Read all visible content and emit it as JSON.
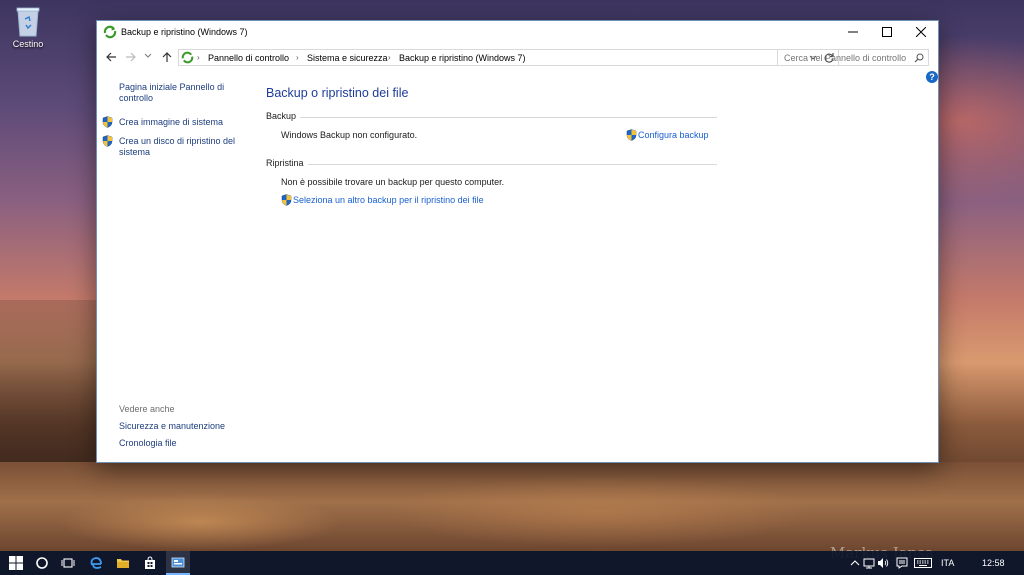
{
  "desktop": {
    "recycle_bin_label": "Cestino",
    "watermark": "Markus Jansa"
  },
  "window": {
    "title": "Backup e ripristino (Windows 7)",
    "controls": [
      "minimize-icon",
      "maximize-icon",
      "close-icon"
    ]
  },
  "address_bar": {
    "breadcrumbs": [
      "Pannello di controllo",
      "Sistema e sicurezza",
      "Backup e ripristino (Windows 7)"
    ],
    "search_placeholder": "Cerca nel Pannello di controllo"
  },
  "left_pane": {
    "home_link": "Pagina iniziale Pannello di controllo",
    "tasks": [
      {
        "label": "Crea immagine di sistema",
        "icon": "uac-shield-icon"
      },
      {
        "label": "Crea un disco di ripristino del sistema",
        "icon": "uac-shield-icon"
      }
    ],
    "see_also_heading": "Vedere anche",
    "see_also": [
      "Sicurezza e manutenzione",
      "Cronologia file"
    ]
  },
  "main": {
    "title": "Backup o ripristino dei file",
    "backup_section": {
      "heading": "Backup",
      "status": "Windows Backup non configurato.",
      "action": "Configura backup"
    },
    "restore_section": {
      "heading": "Ripristina",
      "status": "Non è possibile trovare un backup per questo computer.",
      "action": "Seleziona un altro backup per il ripristino dei file"
    }
  },
  "taskbar": {
    "language": "ITA",
    "time": "12:58",
    "accent_color": "#77b4ff"
  },
  "colors": {
    "link": "#1a5fd1",
    "heading": "#1e3c9a",
    "left_link": "#1d3d7d"
  }
}
